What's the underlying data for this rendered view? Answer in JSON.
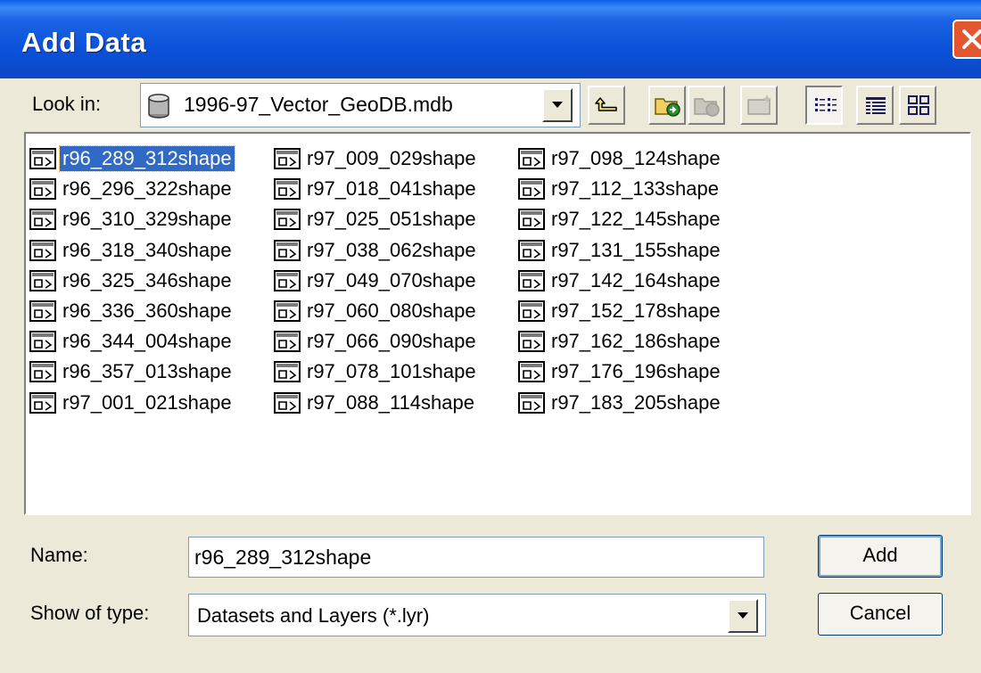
{
  "dialog": {
    "title": "Add Data"
  },
  "look_in": {
    "label": "Look in:",
    "value": "1996-97_Vector_GeoDB.mdb",
    "icon": "database-icon"
  },
  "toolbar": {
    "buttons": [
      "up-one-level-icon",
      "connect-folder-icon",
      "disconnect-folder-icon",
      "new-item-icon",
      "list-view-icon",
      "details-view-icon",
      "thumbnails-view-icon"
    ]
  },
  "files": {
    "icon": "feature-class-icon",
    "selected": "r96_289_312shape",
    "items": [
      "r96_289_312shape",
      "r96_296_322shape",
      "r96_310_329shape",
      "r96_318_340shape",
      "r96_325_346shape",
      "r96_336_360shape",
      "r96_344_004shape",
      "r96_357_013shape",
      "r97_001_021shape",
      "r97_009_029shape",
      "r97_018_041shape",
      "r97_025_051shape",
      "r97_038_062shape",
      "r97_049_070shape",
      "r97_060_080shape",
      "r97_066_090shape",
      "r97_078_101shape",
      "r97_088_114shape",
      "r97_098_124shape",
      "r97_112_133shape",
      "r97_122_145shape",
      "r97_131_155shape",
      "r97_142_164shape",
      "r97_152_178shape",
      "r97_162_186shape",
      "r97_176_196shape",
      "r97_183_205shape"
    ]
  },
  "name_field": {
    "label": "Name:",
    "value": "r96_289_312shape"
  },
  "type_field": {
    "label": "Show of type:",
    "value": "Datasets and Layers (*.lyr)"
  },
  "buttons": {
    "add": "Add",
    "cancel": "Cancel"
  },
  "colors": {
    "title_bar": "#0A54E0",
    "selection": "#316AC5",
    "close_button": "#E3562F",
    "dialog_bg": "#ECE9D8"
  }
}
